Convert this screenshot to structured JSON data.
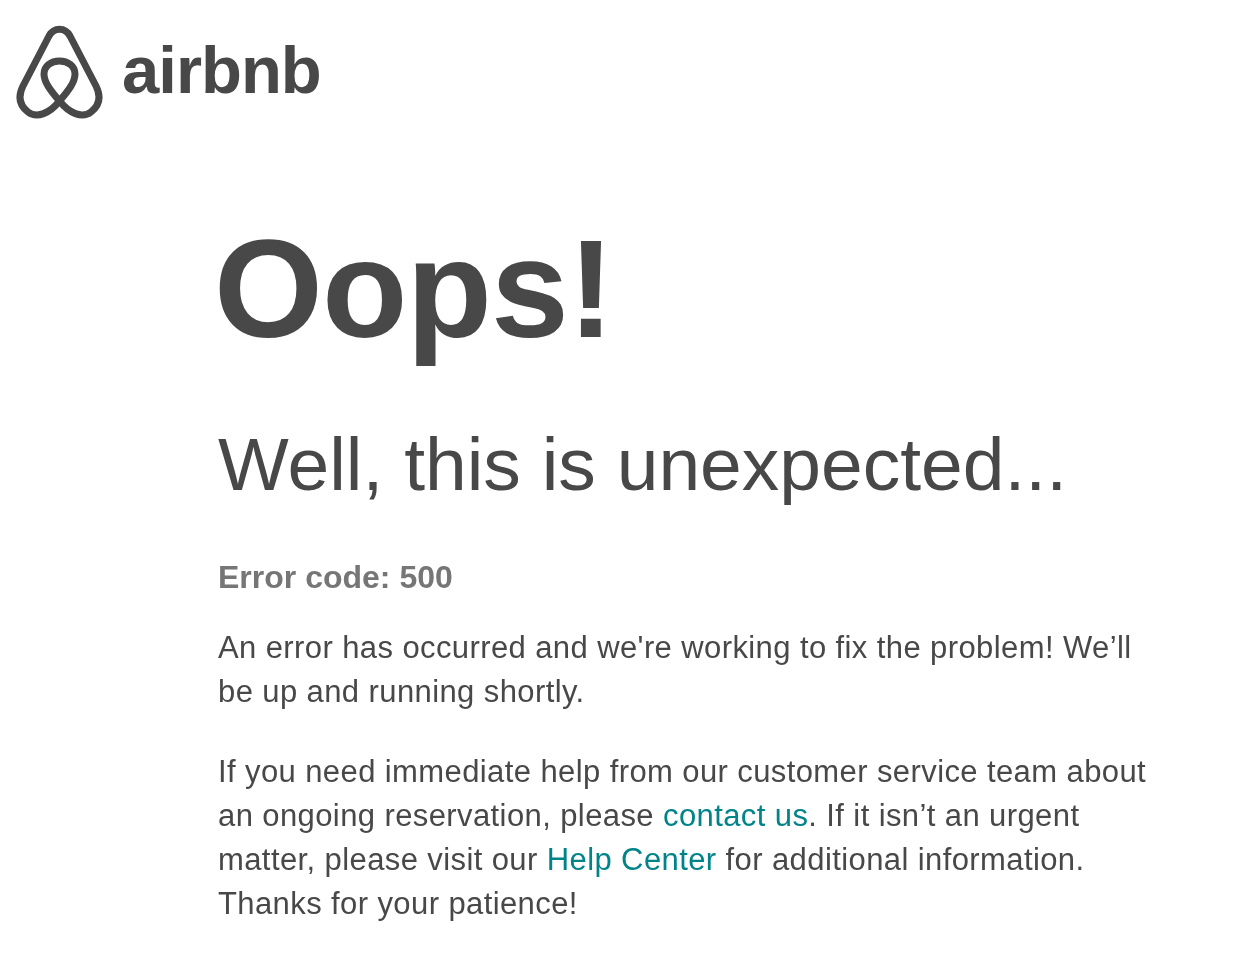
{
  "header": {
    "logo_text": "airbnb"
  },
  "title": "Oops!",
  "subtitle": "Well, this is unexpected...",
  "error_code": "Error code: 500",
  "paragraphs": [
    {
      "parts": [
        {
          "kind": "text",
          "text": "An error has occurred and we're working to fix the problem! We’ll be up and running shortly."
        }
      ]
    },
    {
      "parts": [
        {
          "kind": "text",
          "text": "If you need immediate help from our customer service team about an ongoing reservation, please "
        },
        {
          "kind": "link",
          "text": "contact us"
        },
        {
          "kind": "text",
          "text": ". If it isn’t an urgent matter, please visit our "
        },
        {
          "kind": "link",
          "text": "Help Center"
        },
        {
          "kind": "text",
          "text": " for additional information. Thanks for your patience!"
        }
      ]
    }
  ]
}
